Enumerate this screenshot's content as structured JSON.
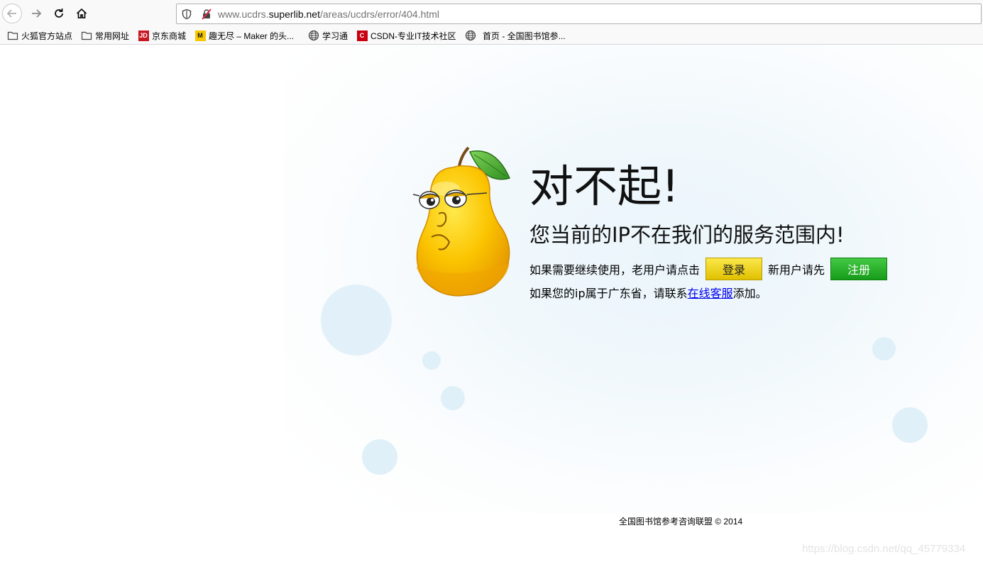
{
  "browser": {
    "url_prefix": "www.ucdrs.",
    "url_domain": "superlib.net",
    "url_path": "/areas/ucdrs/error/404.html"
  },
  "bookmarks": [
    {
      "label": "火狐官方站点",
      "icon": "folder-icon"
    },
    {
      "label": "常用网址",
      "icon": "folder-icon"
    },
    {
      "label": "京东商城",
      "icon": "jd-icon",
      "badge": "JD"
    },
    {
      "label": "趣无尽 – Maker 的头...",
      "icon": "maker-icon",
      "badge": "M"
    },
    {
      "label": "学习通",
      "icon": "globe-icon"
    },
    {
      "label": "CSDN-专业IT技术社区",
      "icon": "csdn-icon",
      "badge": "C"
    },
    {
      "label": "首页 - 全国图书馆参...",
      "icon": "globe-icon"
    }
  ],
  "content": {
    "headline": "对不起!",
    "subline": "您当前的IP不在我们的服务范围内!",
    "prompt_text": "如果需要继续使用，老用户请点击",
    "login_label": "登录",
    "new_user_text": "新用户请先",
    "register_label": "注册",
    "ip_text": "如果您的ip属于广东省，请联系",
    "service_link": "在线客服",
    "ip_text_end": "添加。"
  },
  "footer": {
    "copyright": "全国图书馆参考咨询联盟 © 2014"
  },
  "watermark": "https://blog.csdn.net/qq_45779334",
  "colors": {
    "login_button": "#f0d400",
    "register_button": "#2db52f",
    "link": "#0000ee"
  }
}
